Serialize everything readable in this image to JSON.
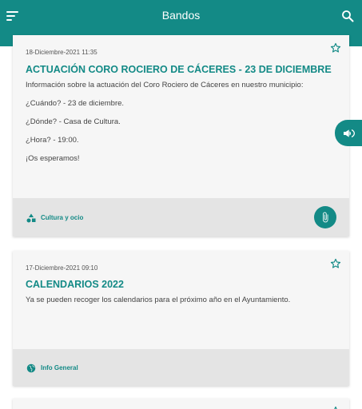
{
  "header": {
    "title": "Bandos",
    "menu_icon": "menu-icon",
    "search_icon": "search-icon"
  },
  "cards": [
    {
      "date": "18-Diciembre-2021 11:35",
      "title": "ACTUACIÓN CORO ROCIERO DE CÁCERES - 23 DE DICIEMBRE",
      "body": [
        "Información sobre la actuación del Coro Rociero de Cáceres en nuestro municipio:",
        "¿Cuándo? - 23 de diciembre.",
        "¿Dónde? - Casa de Cultura.",
        "¿Hora? - 19:00.",
        "¡Os esperamos!"
      ],
      "category": "Cultura y ocio",
      "category_icon": "shapes-icon",
      "has_attachment": true
    },
    {
      "date": "17-Diciembre-2021 09:10",
      "title": "CALENDARIOS 2022",
      "body": [
        "Ya se pueden recoger los calendarios para el próximo año en el Ayuntamiento."
      ],
      "category": "Info General",
      "category_icon": "globe-icon",
      "has_attachment": false
    }
  ],
  "colors": {
    "primary": "#138a86",
    "card_background": "#f6f6f6",
    "card_footer": "#e4e4e4"
  }
}
